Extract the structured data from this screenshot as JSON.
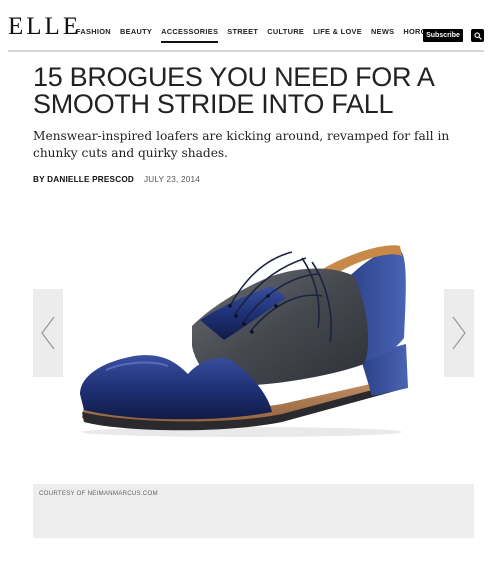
{
  "site": {
    "logo": "ELLE"
  },
  "nav": {
    "items": [
      "FASHION",
      "BEAUTY",
      "ACCESSORIES",
      "STREET",
      "CULTURE",
      "LIFE & LOVE",
      "NEWS",
      "HOROSCOPES"
    ],
    "active": "ACCESSORIES",
    "subscribe_label": "Subscribe",
    "search_icon": "search-icon"
  },
  "article": {
    "headline": "15 BROGUES YOU NEED FOR A SMOOTH STRIDE INTO FALL",
    "dek": "Menswear-inspired loafers are kicking around, revamped for fall in chunky cuts and quirky shades.",
    "byline": "BY DANIELLE PRESCOD",
    "date": "JULY 23, 2014"
  },
  "gallery": {
    "prev_icon": "chevron-left-icon",
    "next_icon": "chevron-right-icon",
    "caption": "COURTESY OF NEIMANMARCUS.COM"
  },
  "colors": {
    "accent": "#000000",
    "arrow_bg": "#ececec",
    "caption_bg": "#ededed",
    "shoe_navy": "#1d2e6b",
    "shoe_gray": "#4a4d55",
    "sole_tan": "#b8835a"
  }
}
